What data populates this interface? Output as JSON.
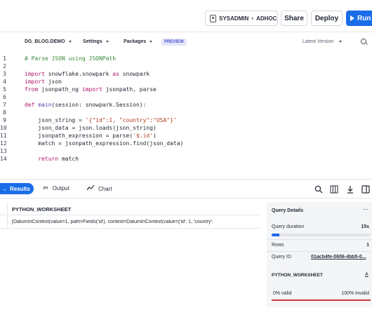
{
  "header": {
    "role": "SYSADMIN",
    "warehouse": "ADHOC",
    "share_label": "Share",
    "deploy_label": "Deploy",
    "run_label": "Run"
  },
  "context": {
    "database": "DG_BLOG.DEMO",
    "settings_label": "Settings",
    "packages_label": "Packages",
    "preview_badge": "PREVIEW",
    "version_label": "Latest Version"
  },
  "editor": {
    "lines": [
      {
        "n": "1",
        "parts": [
          [
            "com",
            "# Parse JSON using JSONPath"
          ]
        ]
      },
      {
        "n": "2",
        "parts": []
      },
      {
        "n": "3",
        "parts": [
          [
            "kw",
            "import "
          ],
          [
            "mod",
            "snowflake.snowpark "
          ],
          [
            "kw",
            "as "
          ],
          [
            "mod",
            "snowpark"
          ]
        ]
      },
      {
        "n": "4",
        "parts": [
          [
            "kw",
            "import "
          ],
          [
            "mod",
            "json"
          ]
        ]
      },
      {
        "n": "5",
        "parts": [
          [
            "kw",
            "from "
          ],
          [
            "mod",
            "jsonpath_ng "
          ],
          [
            "kw",
            "import "
          ],
          [
            "mod",
            "jsonpath, parse"
          ]
        ]
      },
      {
        "n": "6",
        "parts": []
      },
      {
        "n": "7",
        "parts": [
          [
            "kw",
            "def "
          ],
          [
            "fn",
            "main"
          ],
          [
            "mod",
            "(session: snowpark.Session):"
          ]
        ]
      },
      {
        "n": "8",
        "parts": []
      },
      {
        "n": "9",
        "parts": [
          [
            "mod",
            "    json_string = "
          ],
          [
            "str",
            "'{\"id\":1, \"country\":\"USA\"}'"
          ]
        ]
      },
      {
        "n": "10",
        "parts": [
          [
            "mod",
            "    json_data = json.loads(json_string)"
          ]
        ]
      },
      {
        "n": "11",
        "parts": [
          [
            "mod",
            "    jsonpath_expression = parse("
          ],
          [
            "str",
            "'$.id'"
          ],
          [
            "mod",
            ")"
          ]
        ]
      },
      {
        "n": "12",
        "parts": [
          [
            "mod",
            "    match = jsonpath_expression.find(json_data)"
          ]
        ]
      },
      {
        "n": "13",
        "parts": []
      },
      {
        "n": "14",
        "parts": [
          [
            "kw",
            "    return "
          ],
          [
            "mod",
            "match"
          ]
        ]
      }
    ]
  },
  "results_bar": {
    "results_label": "Results",
    "output_prefix": "PY",
    "output_label": "Output",
    "chart_label": "Chart"
  },
  "table": {
    "column": "PYTHON_WORKSHEET",
    "rows": [
      "[DatumInContext(value=1, path=Fields('id'), context=DatumInContext(value={'id': 1, 'country':"
    ]
  },
  "query_details": {
    "title": "Query Details",
    "duration_label": "Query duration",
    "duration_value": "15s",
    "duration_fill": 0.08,
    "rows_label": "Rows",
    "rows_value": "1",
    "query_id_label": "Query ID",
    "query_id_value": "01acb4fe-0606-4bb5-0..."
  },
  "column_stats": {
    "title": "PYTHON_WORKSHEET",
    "type_glyph": "A",
    "valid_label": "0% valid",
    "invalid_label": "100% invalid"
  },
  "colors": {
    "accent": "#1a6ce7",
    "invalid_bar": "#c23b3b"
  }
}
